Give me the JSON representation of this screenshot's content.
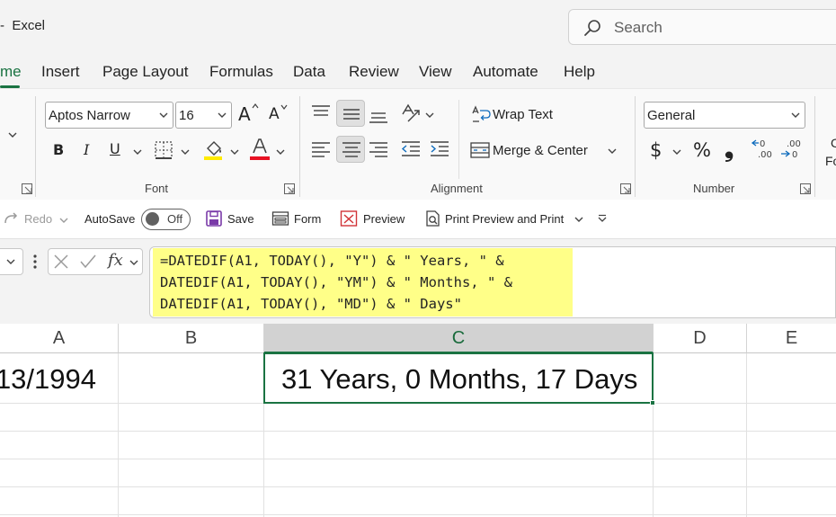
{
  "app": {
    "title": "-  Excel"
  },
  "search": {
    "placeholder": "Search"
  },
  "menu": {
    "tabs": [
      {
        "label": "me",
        "active": true
      },
      {
        "label": "Insert"
      },
      {
        "label": "Page Layout"
      },
      {
        "label": "Formulas"
      },
      {
        "label": "Data"
      },
      {
        "label": "Review"
      },
      {
        "label": "View"
      },
      {
        "label": "Automate"
      },
      {
        "label": "Help"
      }
    ]
  },
  "ribbon": {
    "font": {
      "name": "Aptos Narrow",
      "size": "16",
      "grow": "A",
      "shrink": "A",
      "bold": "B",
      "italic": "I",
      "underline": "U",
      "group_label": "Font",
      "highlight_color": "#ffeb00",
      "font_color": "#e81123"
    },
    "alignment": {
      "wrap_text": "Wrap Text",
      "merge_center": "Merge & Center",
      "group_label": "Alignment"
    },
    "number": {
      "format": "General",
      "currency": "$",
      "percent": "%",
      "comma": "❟",
      "group_label": "Number"
    },
    "clipped": {
      "line1": "C",
      "line2": "Fo"
    }
  },
  "qat": {
    "redo": "Redo",
    "autosave": "AutoSave",
    "toggle": "Off",
    "save": "Save",
    "form": "Form",
    "preview": "Preview",
    "print_preview": "Print Preview and Print"
  },
  "formula_bar": {
    "fx": "fx",
    "lines": [
      "=DATEDIF(A1, TODAY(), \"Y\") & \" Years, \" &",
      "DATEDIF(A1, TODAY(), \"YM\") & \" Months, \" &",
      "DATEDIF(A1, TODAY(), \"MD\") & \" Days\""
    ],
    "highlight_color": "#ffff88"
  },
  "grid": {
    "columns": [
      "A",
      "B",
      "C",
      "D",
      "E"
    ],
    "selected_column": "C",
    "cells": {
      "A1": "13/1994",
      "C1": "31 Years, 0 Months, 17 Days"
    },
    "accent": "#1a7342"
  }
}
